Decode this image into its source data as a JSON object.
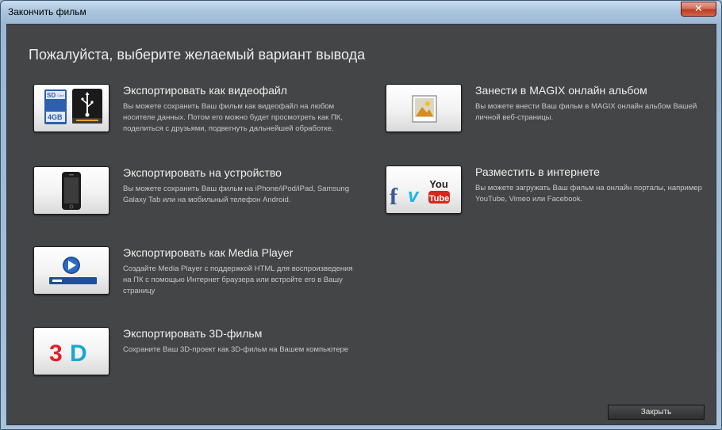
{
  "window": {
    "title": "Закончить фильм",
    "close_glyph": "✕"
  },
  "heading": "Пожалуйста, выберите желаемый вариант вывода",
  "options": [
    {
      "title": "Экспортировать как видеофайл",
      "description": "Вы можете сохранить Ваш фильм как видеофайл на любом носителе данных. Потом его можно будет просмотреть как ПК, поделиться с друзьями, подвегнуть дальнейшей обработке.",
      "icon": "sd-card-usb-icon",
      "icon_text": {
        "sd": "SD",
        "card": "Card",
        "size": "4GB"
      }
    },
    {
      "title": "Экспортировать на устройство",
      "description": "Вы можете сохранить Ваш фильм на iPhone/iPod/iPad, Samsung Galaxy Tab или на мобильный телефон Android.",
      "icon": "smartphone-icon"
    },
    {
      "title": "Экспортировать как Media Player",
      "description": "Создайте Media Player с поддержкой HTML для воспроизведения на ПК с помощью Интернет браузера или встройте его в Вашу страницу",
      "icon": "media-player-icon"
    },
    {
      "title": "Экспортировать 3D-фильм",
      "description": "Сохраните Ваш 3D-проект как 3D-фильм на Вашем компьютере",
      "icon": "3d-icon",
      "icon_text": {
        "three": "3",
        "d": "D"
      }
    },
    {
      "title": "Занести в MAGIX онлайн альбом",
      "description": "Вы можете внести Ваш фильм в MAGIX онлайн альбом Вашей личной веб-страницы.",
      "icon": "photo-album-icon"
    },
    {
      "title": "Разместить в интернете",
      "description": "Вы можете загружать Ваш фильм на онлайн порталы, например YouTube, Vimeo или Facebook.",
      "icon": "social-media-icon",
      "icon_text": {
        "facebook": "f",
        "vimeo": "v",
        "you": "You",
        "tube": "Tube"
      }
    }
  ],
  "close_button_label": "Закрыть",
  "colors": {
    "dialog_bg": "#444546",
    "youtube_red": "#d8261c",
    "facebook_blue": "#3b5998",
    "vimeo_blue": "#1ab7ea",
    "three_d_red": "#e0202a",
    "three_d_cyan": "#19a7d3"
  }
}
